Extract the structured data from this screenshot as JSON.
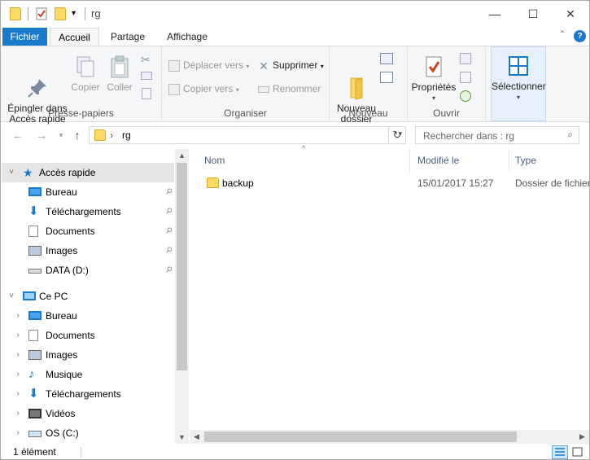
{
  "window": {
    "title": "rg",
    "controls": {
      "minimize": "—",
      "maximize": "☐",
      "close": "✕"
    }
  },
  "ribbon_tabs": [
    "Fichier",
    "Accueil",
    "Partage",
    "Affichage"
  ],
  "ribbon": {
    "clipboard": {
      "label": "Presse-papiers",
      "pin": "Épingler dans\nAccès rapide",
      "copy": "Copier",
      "paste": "Coller"
    },
    "organize": {
      "label": "Organiser",
      "move_to": "Déplacer vers",
      "copy_to": "Copier vers",
      "delete": "Supprimer",
      "rename": "Renommer"
    },
    "new": {
      "label": "Nouveau",
      "new_folder": "Nouveau\ndossier"
    },
    "open": {
      "label": "Ouvrir",
      "properties": "Propriétés"
    },
    "select": {
      "label": "Sélectionner"
    }
  },
  "address": {
    "breadcrumb": "rg",
    "search_placeholder": "Rechercher dans : rg"
  },
  "nav_pane": {
    "quick_access": {
      "label": "Accès rapide",
      "items": [
        {
          "label": "Bureau",
          "icon": "desktop-icon"
        },
        {
          "label": "Téléchargements",
          "icon": "download-icon"
        },
        {
          "label": "Documents",
          "icon": "documents-icon"
        },
        {
          "label": "Images",
          "icon": "pictures-icon"
        },
        {
          "label": "DATA (D:)",
          "icon": "drive-icon"
        }
      ]
    },
    "this_pc": {
      "label": "Ce PC",
      "items": [
        {
          "label": "Bureau",
          "icon": "desktop-icon"
        },
        {
          "label": "Documents",
          "icon": "documents-icon"
        },
        {
          "label": "Images",
          "icon": "pictures-icon"
        },
        {
          "label": "Musique",
          "icon": "music-icon"
        },
        {
          "label": "Téléchargements",
          "icon": "download-icon"
        },
        {
          "label": "Vidéos",
          "icon": "videos-icon"
        },
        {
          "label": "OS (C:)",
          "icon": "system-drive-icon"
        }
      ]
    }
  },
  "file_list": {
    "columns": [
      "Nom",
      "Modifié le",
      "Type"
    ],
    "rows": [
      {
        "name": "backup",
        "modified": "15/01/2017 15:27",
        "type": "Dossier de fichiers"
      }
    ]
  },
  "status_bar": {
    "item_count": "1 élément"
  },
  "colors": {
    "accent": "#1979ca",
    "selection": "#cce8ff",
    "folder": "#ffd966"
  }
}
